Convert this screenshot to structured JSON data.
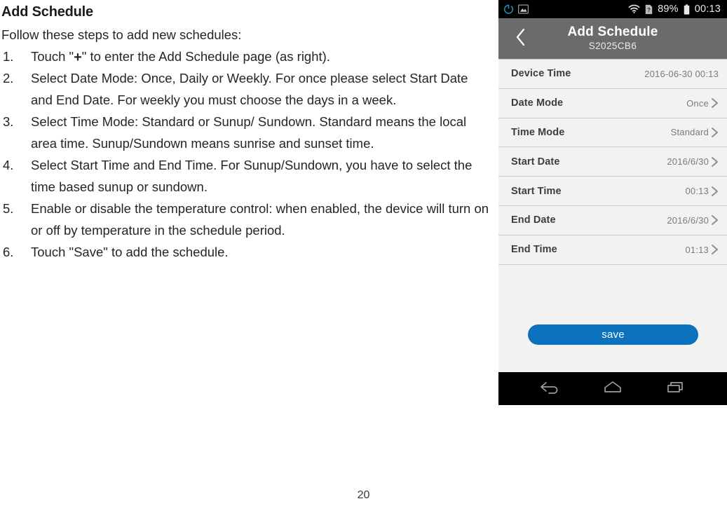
{
  "document": {
    "title": "Add Schedule",
    "intro": "Follow these steps to add new schedules:",
    "steps": [
      {
        "num": "1.",
        "pre": "Touch \"",
        "glyph": "+",
        "post": "\" to enter the Add Schedule page (as right)."
      },
      {
        "num": "2.",
        "text": "Select Date Mode: Once, Daily or Weekly. For once please select Start Date and End Date. For weekly you must choose the days in a week."
      },
      {
        "num": "3.",
        "text": "Select Time Mode: Standard or Sunup/ Sundown. Standard means the local area time. Sunup/Sundown means sunrise and sunset time."
      },
      {
        "num": "4.",
        "text": "Select Start Time and End Time. For Sunup/Sundown, you have to select the time based sunup or sundown."
      },
      {
        "num": "5.",
        "text": "Enable or disable the temperature control: when enabled, the device will turn on or off by temperature in the schedule period."
      },
      {
        "num": "6.",
        "text": "Touch \"Save\" to add the schedule."
      }
    ],
    "page_number": "20"
  },
  "phone": {
    "statusbar": {
      "power_icon": "power-icon",
      "screenshot_icon": "screenshot-icon",
      "wifi_icon": "wifi-icon",
      "sim_icon": "sim-unknown-icon",
      "battery_percent": "89%",
      "battery_icon": "battery-icon",
      "clock": "00:13"
    },
    "appbar": {
      "back_icon": "chevron-left-icon",
      "title": "Add Schedule",
      "subtitle": "S2025CB6"
    },
    "rows": [
      {
        "label": "Device Time",
        "value": "2016-06-30  00:13",
        "chevron": false
      },
      {
        "label": "Date Mode",
        "value": "Once",
        "chevron": true
      },
      {
        "label": "Time Mode",
        "value": "Standard",
        "chevron": true
      },
      {
        "label": "Start Date",
        "value": "2016/6/30",
        "chevron": true
      },
      {
        "label": "Start Time",
        "value": "00:13",
        "chevron": true
      },
      {
        "label": "End Date",
        "value": "2016/6/30",
        "chevron": true
      },
      {
        "label": "End Time",
        "value": "01:13",
        "chevron": true
      }
    ],
    "save_label": "save",
    "navbar": {
      "back_icon": "nav-back-icon",
      "home_icon": "nav-home-icon",
      "recents_icon": "nav-recents-icon"
    },
    "colors": {
      "accent": "#0d72bd",
      "appbar": "#6b6b6b",
      "list_bg": "#f2f2f2",
      "divider": "#c9c9c9",
      "status_bg": "#000000"
    }
  }
}
